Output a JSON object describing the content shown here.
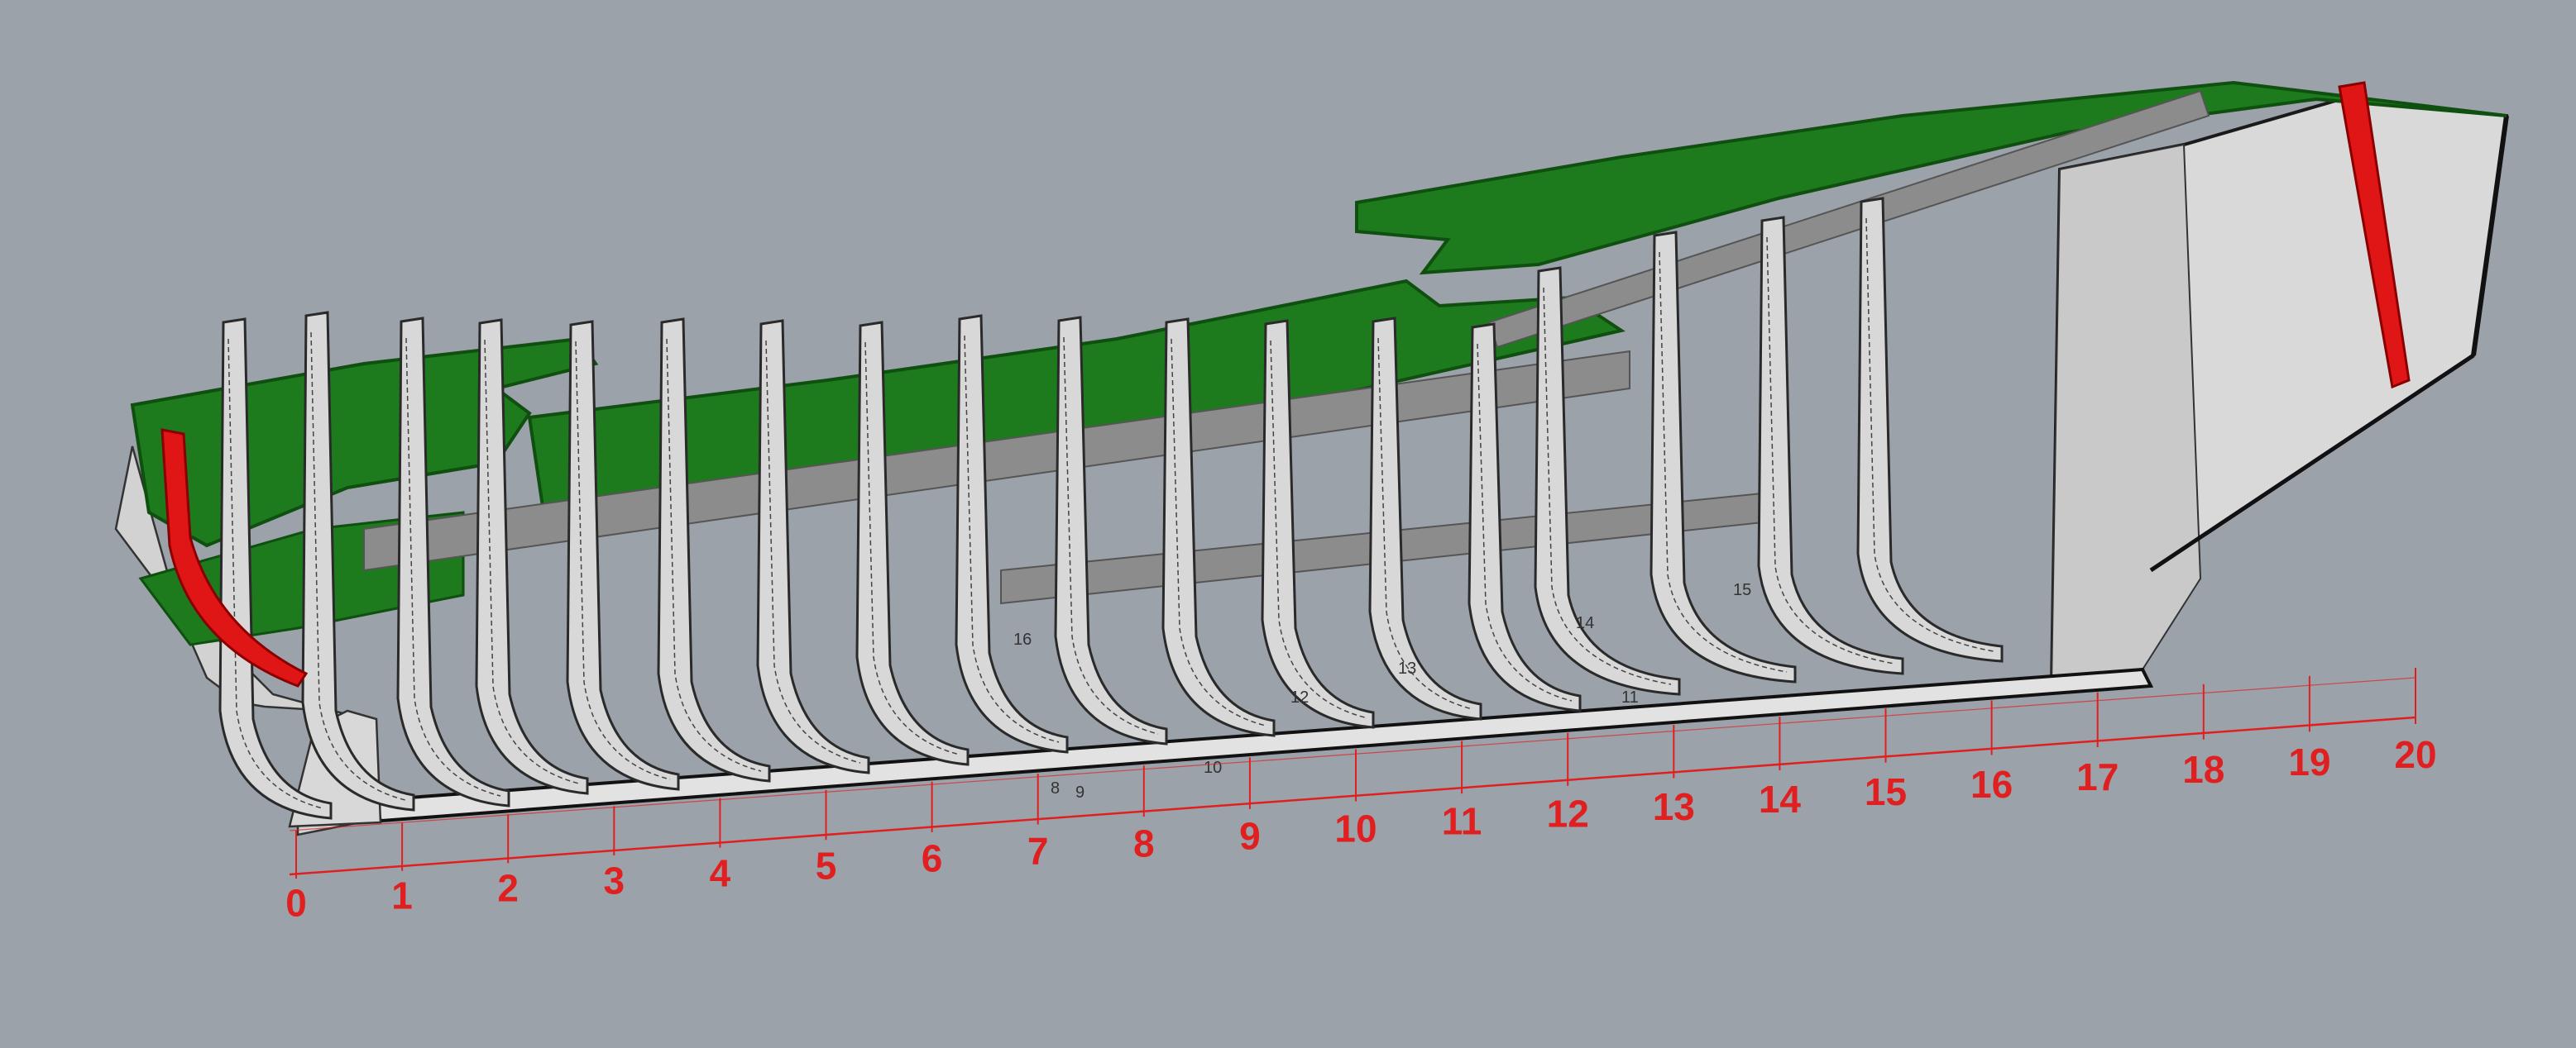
{
  "viewport": {
    "background": "#9ba2aa",
    "deck_color": "#1d7a1d",
    "deck_edge_color": "#0f4f0f",
    "frame_color": "#d8d8d8",
    "frame_edge_color": "#2a2a2a",
    "stem_color": "#e01515",
    "station_color": "#e02020",
    "hull_color": "#d4d4d4",
    "girder_color": "#8a8a8a"
  },
  "stations": {
    "labels": [
      "0",
      "1",
      "2",
      "3",
      "4",
      "5",
      "6",
      "7",
      "8",
      "9",
      "10",
      "11",
      "12",
      "13",
      "14",
      "15",
      "16",
      "17",
      "18",
      "19",
      "20"
    ]
  },
  "frame_numbers": [
    "16",
    "15",
    "14",
    "13",
    "12",
    "11",
    "10",
    "9",
    "8"
  ]
}
